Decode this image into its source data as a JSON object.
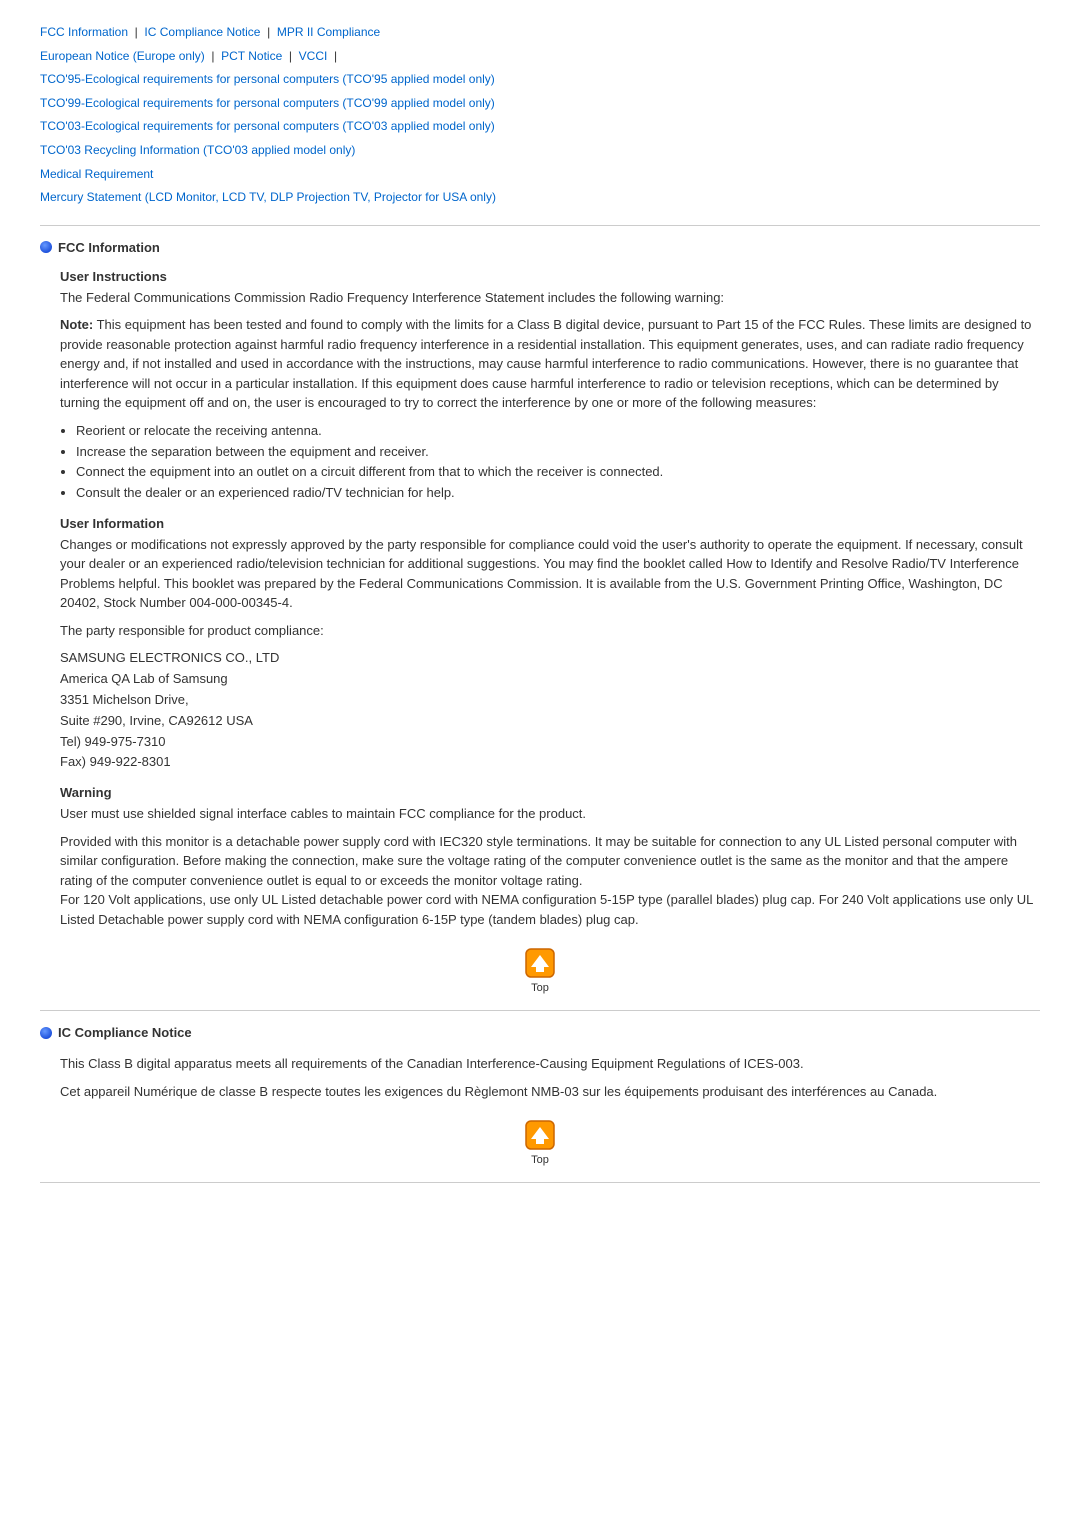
{
  "nav": {
    "links": [
      {
        "label": "FCC Information",
        "id": "fcc-info"
      },
      {
        "label": "IC Compliance Notice",
        "id": "ic-compliance"
      },
      {
        "label": "MPR II Compliance",
        "id": "mpr"
      },
      {
        "label": "European Notice (Europe only)",
        "id": "european"
      },
      {
        "label": "PCT Notice",
        "id": "pct"
      },
      {
        "label": "VCCI",
        "id": "vcci"
      },
      {
        "label": "TCO'95-Ecological requirements for personal computers (TCO'95 applied model only)",
        "id": "tco95"
      },
      {
        "label": "TCO'99-Ecological requirements for personal computers (TCO'99 applied model only)",
        "id": "tco99"
      },
      {
        "label": "TCO'03-Ecological requirements for personal computers (TCO'03 applied model only)",
        "id": "tco03"
      },
      {
        "label": "TCO'03 Recycling Information (TCO'03 applied model only)",
        "id": "tco03r"
      },
      {
        "label": "Medical Requirement",
        "id": "medical"
      },
      {
        "label": "Mercury Statement (LCD Monitor, LCD TV, DLP Projection TV, Projector for USA only)",
        "id": "mercury"
      }
    ]
  },
  "fcc_section": {
    "header": "FCC Information",
    "user_instructions": {
      "title": "User Instructions",
      "intro": "The Federal Communications Commission Radio Frequency Interference Statement includes the following warning:",
      "note_text": "This equipment has been tested and found to comply with the limits for a Class B digital device, pursuant to Part 15 of the FCC Rules. These limits are designed to provide reasonable protection against harmful radio frequency interference in a residential installation. This equipment generates, uses, and can radiate radio frequency energy and, if not installed and used in accordance with the instructions, may cause harmful interference to radio communications. However, there is no guarantee that interference will not occur in a particular installation. If this equipment does cause harmful interference to radio or television receptions, which can be determined by turning the equipment off and on, the user is encouraged to try to correct the interference by one or more of the following measures:",
      "bullets": [
        "Reorient or relocate the receiving antenna.",
        "Increase the separation between the equipment and receiver.",
        "Connect the equipment into an outlet on a circuit different from that to which the receiver is connected.",
        "Consult the dealer or an experienced radio/TV technician for help."
      ]
    },
    "user_information": {
      "title": "User Information",
      "para1": "Changes or modifications not expressly approved by the party responsible for compliance could void the user's authority to operate the equipment. If necessary, consult your dealer or an experienced radio/television technician for additional suggestions. You may find the booklet called How to Identify and Resolve Radio/TV Interference Problems helpful. This booklet was prepared by the Federal Communications Commission. It is available from the U.S. Government Printing Office, Washington, DC 20402, Stock Number 004-000-00345-4.",
      "para2": "The party responsible for product compliance:",
      "address": "SAMSUNG ELECTRONICS CO., LTD\nAmerica QA Lab of Samsung\n3351 Michelson Drive,\nSuite #290, Irvine, CA92612 USA\nTel) 949-975-7310\nFax) 949-922-8301"
    },
    "warning": {
      "title": "Warning",
      "para1": "User must use shielded signal interface cables to maintain FCC compliance for the product.",
      "para2": "Provided with this monitor is a detachable power supply cord with IEC320 style terminations. It may be suitable for connection to any UL Listed personal computer with similar configuration. Before making the connection, make sure the voltage rating of the computer convenience outlet is the same as the monitor and that the ampere rating of the computer convenience outlet is equal to or exceeds the monitor voltage rating.\nFor 120 Volt applications, use only UL Listed detachable power cord with NEMA configuration 5-15P type (parallel blades) plug cap. For 240 Volt applications use only UL Listed Detachable power supply cord with NEMA configuration 6-15P type (tandem blades) plug cap."
    }
  },
  "ic_section": {
    "header": "IC Compliance Notice",
    "para1": "This Class B digital apparatus meets all requirements of the Canadian Interference-Causing Equipment Regulations of ICES-003.",
    "para2": "Cet appareil Numérique de classe B respecte toutes les exigences du Règlemont NMB-03 sur les équipements produisant des interférences au Canada."
  },
  "top_button_label": "Top"
}
